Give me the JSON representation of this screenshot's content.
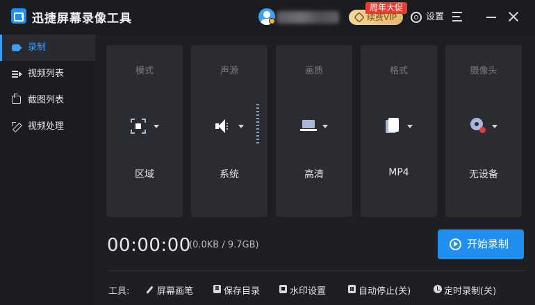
{
  "app": {
    "title": "迅捷屏幕录像工具"
  },
  "header": {
    "vip_label": "续费VIP",
    "vip_promo": "周年大促",
    "settings_label": "设置"
  },
  "sidebar": {
    "items": [
      {
        "label": "录制",
        "icon": "video-camera-icon",
        "active": true
      },
      {
        "label": "视频列表",
        "icon": "video-list-icon",
        "active": false
      },
      {
        "label": "截图列表",
        "icon": "screenshot-list-icon",
        "active": false
      },
      {
        "label": "视频处理",
        "icon": "video-edit-icon",
        "active": false
      }
    ]
  },
  "settings_cards": [
    {
      "title": "模式",
      "value": "区域",
      "icon": "region-select-icon"
    },
    {
      "title": "声源",
      "value": "系统",
      "icon": "speaker-icon"
    },
    {
      "title": "画质",
      "value": "高清",
      "icon": "laptop-icon"
    },
    {
      "title": "格式",
      "value": "MP4",
      "icon": "file-icon"
    },
    {
      "title": "摄像头",
      "value": "无设备",
      "icon": "webcam-off-icon"
    }
  ],
  "recording": {
    "timer": "00:00:00",
    "size_info": "(0.0KB / 9.7GB)",
    "start_label": "开始录制"
  },
  "tools": {
    "label": "工具:",
    "items": [
      {
        "label": "屏幕画笔",
        "icon": "pen-icon"
      },
      {
        "label": "保存目录",
        "icon": "folder-save-icon"
      },
      {
        "label": "水印设置",
        "icon": "watermark-icon"
      },
      {
        "label": "自动停止(关)",
        "icon": "auto-stop-icon"
      },
      {
        "label": "定时录制(关)",
        "icon": "clock-icon"
      }
    ]
  },
  "colors": {
    "accent": "#1f90f2",
    "vip_promo": "#e83a2e",
    "background": "#1e1f23",
    "card": "#2b2c31"
  }
}
